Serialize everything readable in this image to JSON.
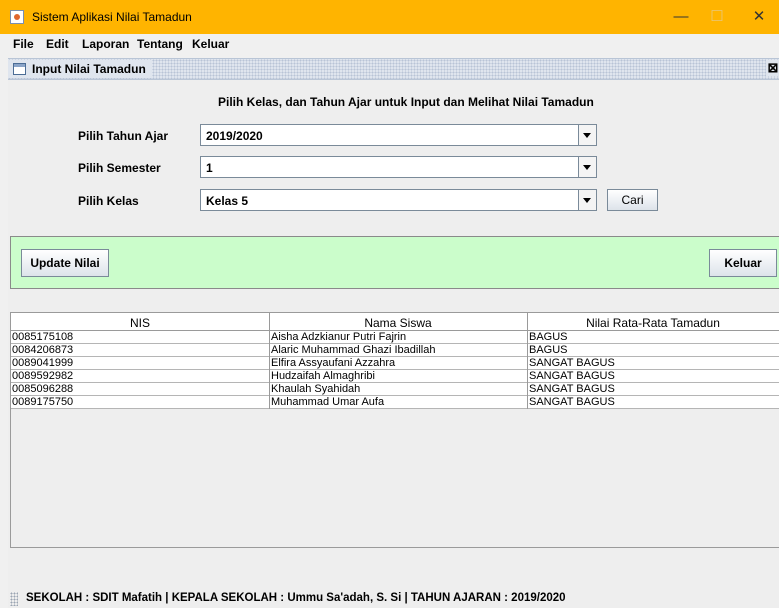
{
  "window": {
    "title": "Sistem Aplikasi Nilai Tamadun",
    "minimize": "—",
    "maximize": "☐",
    "close": "✕"
  },
  "menu": [
    "File",
    "Edit",
    "Laporan",
    "Tentang",
    "Keluar"
  ],
  "internal_frame": {
    "title": "Input Nilai Tamadun",
    "close": "⊠"
  },
  "form": {
    "heading": "Pilih Kelas, dan Tahun Ajar untuk Input dan Melihat Nilai Tamadun",
    "tahun_label": "Pilih Tahun Ajar",
    "tahun_value": "2019/2020",
    "semester_label": "Pilih Semester",
    "semester_value": "1",
    "kelas_label": "Pilih Kelas",
    "kelas_value": "Kelas 5",
    "cari_button": "Cari"
  },
  "actions": {
    "update_button": "Update Nilai",
    "keluar_button": "Keluar"
  },
  "table": {
    "columns": [
      "NIS",
      "Nama Siswa",
      "Nilai Rata-Rata Tamadun"
    ],
    "rows": [
      [
        "0085175108",
        "Aisha Adzkianur Putri Fajrin",
        "BAGUS"
      ],
      [
        "0084206873",
        "Alaric Muhammad Ghazi Ibadillah",
        "BAGUS"
      ],
      [
        "0089041999",
        "Elfira Assyaufani Azzahra",
        "SANGAT BAGUS"
      ],
      [
        "0089592982",
        "Hudzaifah Almaghribi",
        "SANGAT BAGUS"
      ],
      [
        "0085096288",
        "Khaulah Syahidah",
        "SANGAT BAGUS"
      ],
      [
        "0089175750",
        "Muhammad Umar Aufa",
        "SANGAT BAGUS"
      ]
    ]
  },
  "status": {
    "text": "SEKOLAH : SDIT Mafatih | KEPALA SEKOLAH : Ummu Sa'adah, S. Si  | TAHUN AJARAN : 2019/2020"
  },
  "colors": {
    "titlebar": "#ffb400",
    "action_panel": "#cbfdcb"
  }
}
